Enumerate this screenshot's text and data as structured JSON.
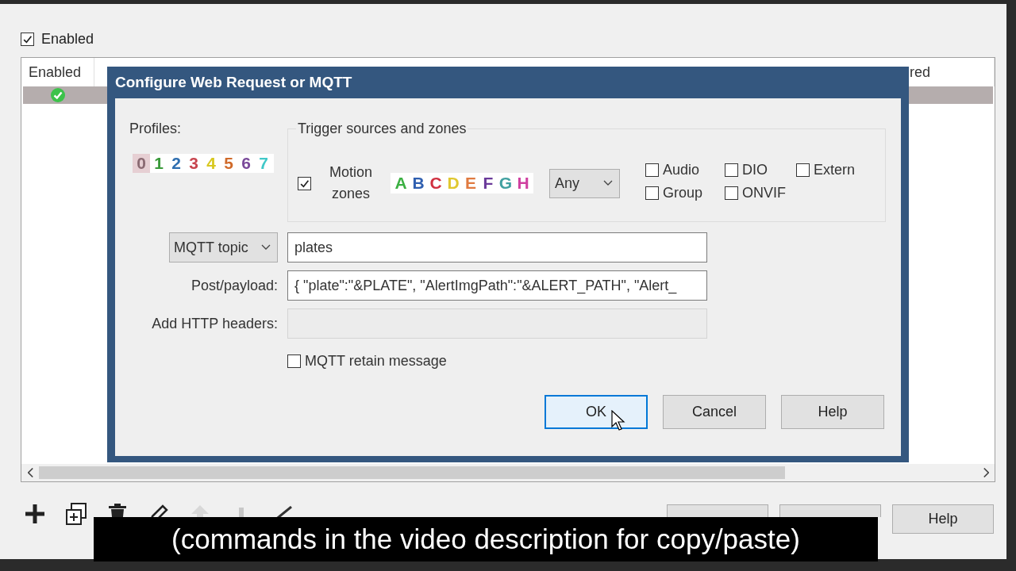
{
  "window": {
    "enabled_checkbox": {
      "label": "Enabled",
      "checked": true
    },
    "list": {
      "columns": [
        {
          "label": "Enabled"
        },
        {
          "label": "red"
        }
      ],
      "rows": [
        {
          "enabled": true,
          "selected": true
        }
      ]
    },
    "bottom_buttons": [
      {
        "kind": "covered"
      },
      {
        "kind": "covered"
      },
      {
        "kind": "labeled",
        "label": "Help"
      }
    ]
  },
  "dialog": {
    "title": "Configure Web Request or MQTT",
    "profiles": {
      "label": "Profiles:",
      "items": [
        {
          "label": "0",
          "color": "#8a6a72",
          "selected": true
        },
        {
          "label": "1",
          "color": "#3a9a3a",
          "selected": false
        },
        {
          "label": "2",
          "color": "#2f6fb0",
          "selected": false
        },
        {
          "label": "3",
          "color": "#c8454f",
          "selected": false
        },
        {
          "label": "4",
          "color": "#d8c820",
          "selected": false
        },
        {
          "label": "5",
          "color": "#d06a2a",
          "selected": false
        },
        {
          "label": "6",
          "color": "#7a4a9a",
          "selected": false
        },
        {
          "label": "7",
          "color": "#40c8c8",
          "selected": false
        }
      ]
    },
    "trigger": {
      "title": "Trigger sources and zones",
      "motion": {
        "label": "Motion zones",
        "checked": true
      },
      "zones": [
        {
          "label": "A",
          "color": "#3cb043"
        },
        {
          "label": "B",
          "color": "#2f5fb0"
        },
        {
          "label": "C",
          "color": "#d03040"
        },
        {
          "label": "D",
          "color": "#e0c830"
        },
        {
          "label": "E",
          "color": "#e07a40"
        },
        {
          "label": "F",
          "color": "#6a3a9a"
        },
        {
          "label": "G",
          "color": "#40a0a0"
        },
        {
          "label": "H",
          "color": "#d040a0"
        }
      ],
      "zone_mode": "Any",
      "sources": [
        {
          "label": "Audio",
          "checked": false
        },
        {
          "label": "DIO",
          "checked": false
        },
        {
          "label": "Extern",
          "checked": false
        },
        {
          "label": "Group",
          "checked": false
        },
        {
          "label": "ONVIF",
          "checked": false
        }
      ]
    },
    "target_type": "MQTT topic",
    "topic": "plates",
    "payload": {
      "label": "Post/payload:",
      "value": "{ \"plate\":\"&PLATE\", \"AlertImgPath\":\"&ALERT_PATH\", \"Alert_"
    },
    "headers": {
      "label": "Add HTTP headers:",
      "disabled": true
    },
    "retain": {
      "label": "MQTT retain message",
      "checked": false
    },
    "buttons": [
      {
        "label": "OK",
        "selected": true
      },
      {
        "label": "Cancel",
        "selected": false
      },
      {
        "label": "Help",
        "selected": false
      }
    ]
  },
  "caption": "(commands in the video description for copy/paste)"
}
